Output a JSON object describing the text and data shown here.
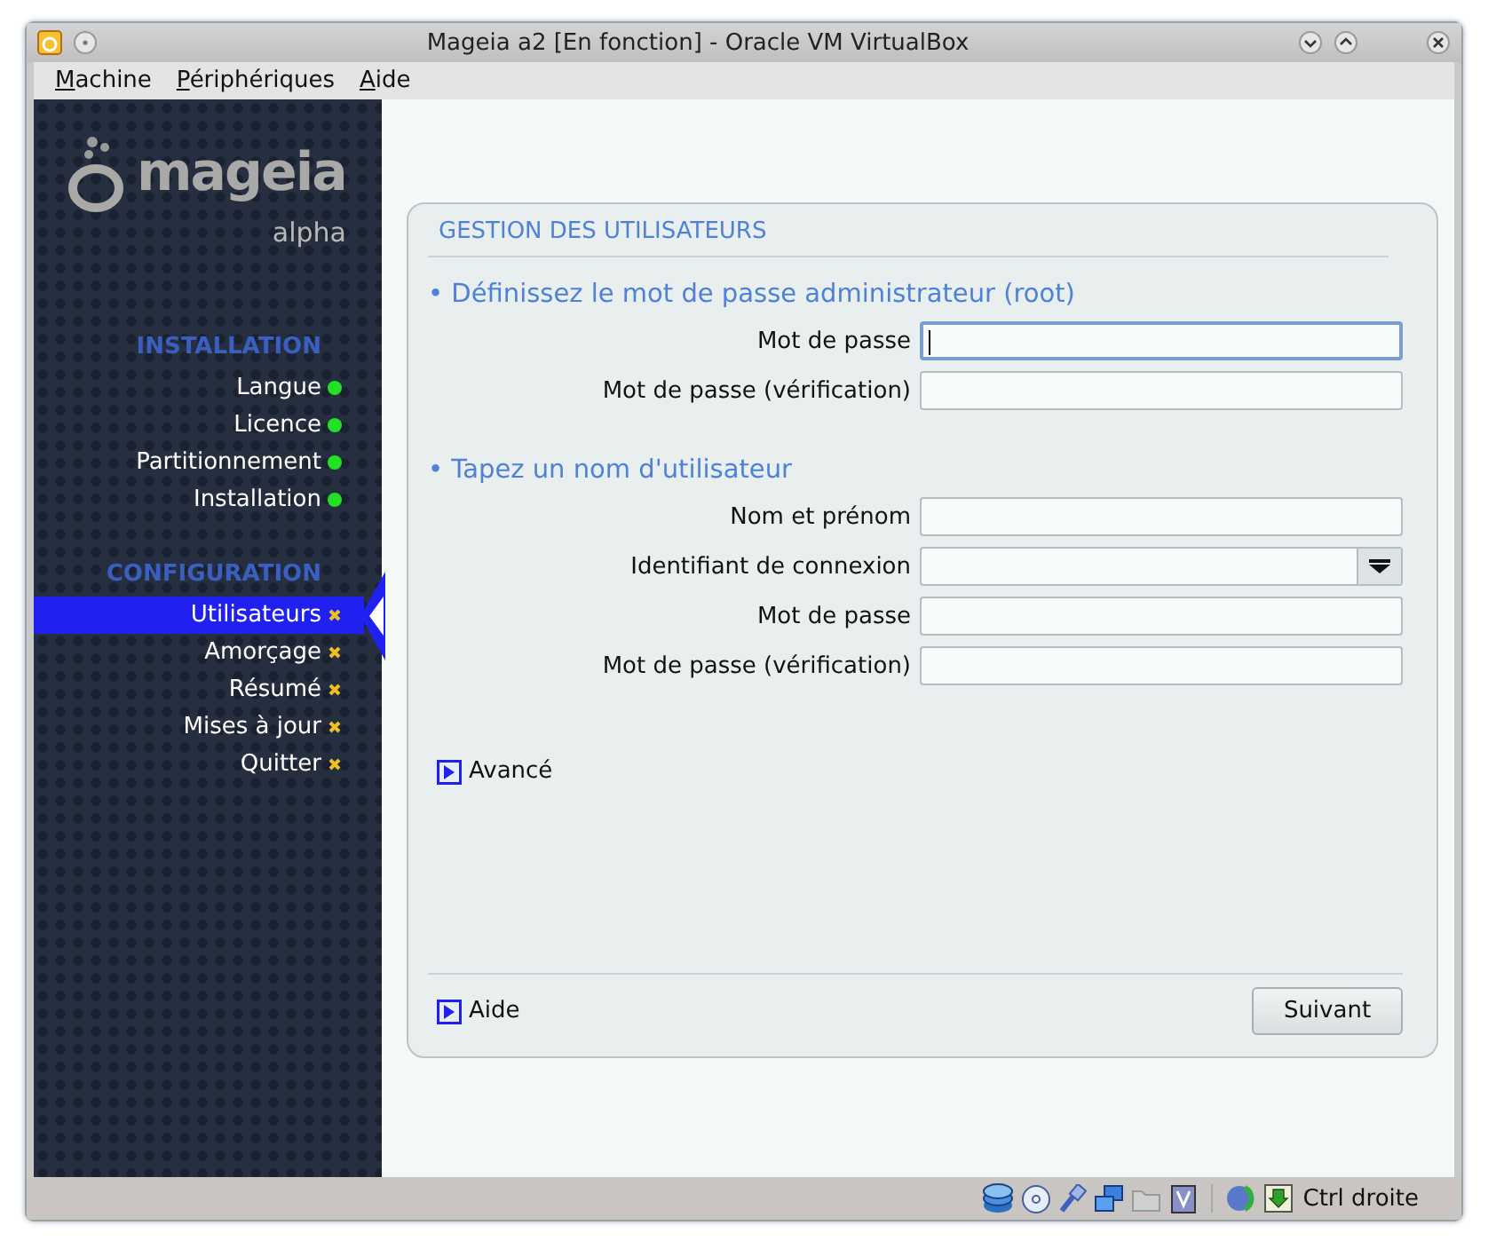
{
  "window": {
    "title": "Mageia a2 [En fonction] - Oracle VM VirtualBox"
  },
  "menu": [
    {
      "label": "Machine"
    },
    {
      "label": "Périphériques"
    },
    {
      "label": "Aide"
    }
  ],
  "sidebar": {
    "logo": {
      "name": "mageia",
      "edition": "alpha"
    },
    "sections": [
      {
        "title": "INSTALLATION",
        "items": [
          {
            "label": "Langue",
            "done": true,
            "selected": false
          },
          {
            "label": "Licence",
            "done": true,
            "selected": false
          },
          {
            "label": "Partitionnement",
            "done": true,
            "selected": false
          },
          {
            "label": "Installation",
            "done": true,
            "selected": false
          }
        ]
      },
      {
        "title": "CONFIGURATION",
        "items": [
          {
            "label": "Utilisateurs",
            "done": false,
            "selected": true
          },
          {
            "label": "Amorçage",
            "done": false,
            "selected": false
          },
          {
            "label": "Résumé",
            "done": false,
            "selected": false
          },
          {
            "label": "Mises à jour",
            "done": false,
            "selected": false
          },
          {
            "label": "Quitter",
            "done": false,
            "selected": false
          }
        ]
      }
    ]
  },
  "page": {
    "title": "GESTION DES UTILISATEURS",
    "sections": [
      {
        "heading": "• Définissez le mot de passe administrateur (root)",
        "fields": [
          {
            "label": "Mot de passe",
            "kind": "text",
            "focused": true
          },
          {
            "label": "Mot de passe (vérification)",
            "kind": "text",
            "focused": false
          }
        ]
      },
      {
        "heading": "• Tapez un nom d'utilisateur",
        "fields": [
          {
            "label": "Nom et prénom",
            "kind": "text",
            "focused": false
          },
          {
            "label": "Identifiant de connexion",
            "kind": "combo",
            "focused": false
          },
          {
            "label": "Mot de passe",
            "kind": "text",
            "focused": false
          },
          {
            "label": "Mot de passe (vérification)",
            "kind": "text",
            "focused": false
          }
        ]
      }
    ],
    "advanced": {
      "label": "Avancé",
      "expanded": false
    },
    "help": {
      "label": "Aide",
      "expanded": false
    },
    "next_button": "Suivant"
  },
  "status_bar": {
    "host_key": "Ctrl droite"
  }
}
